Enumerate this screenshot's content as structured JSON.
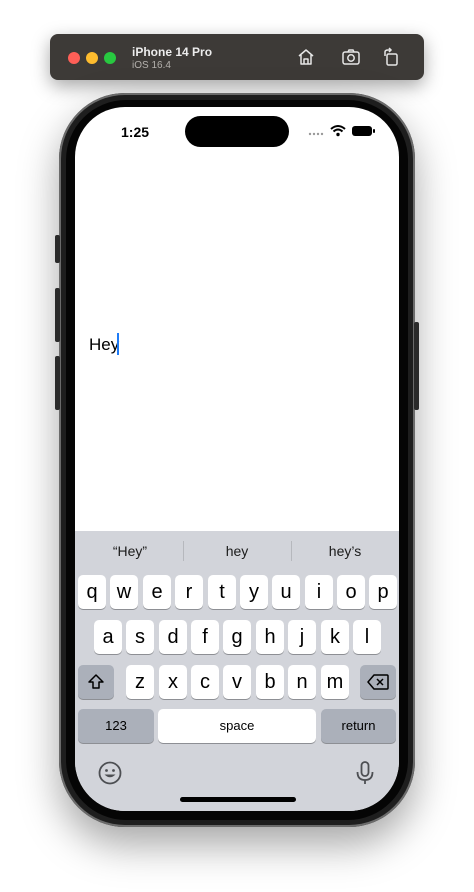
{
  "simulator": {
    "device_name": "iPhone 14 Pro",
    "os_version": "iOS 16.4",
    "toolbar_icons": [
      "home-icon",
      "screenshot-icon",
      "rotate-icon"
    ]
  },
  "status_bar": {
    "time": "1:25",
    "icons": [
      "cellular-dots-icon",
      "wifi-icon",
      "battery-icon"
    ]
  },
  "editor": {
    "text": "Hey",
    "caret_color": "#1f7bf6"
  },
  "keyboard": {
    "suggestions": [
      "“Hey”",
      "hey",
      "hey’s"
    ],
    "rows": [
      [
        "q",
        "w",
        "e",
        "r",
        "t",
        "y",
        "u",
        "i",
        "o",
        "p"
      ],
      [
        "a",
        "s",
        "d",
        "f",
        "g",
        "h",
        "j",
        "k",
        "l"
      ],
      [
        "z",
        "x",
        "c",
        "v",
        "b",
        "n",
        "m"
      ]
    ],
    "numbers_label": "123",
    "space_label": "space",
    "return_label": "return",
    "icons": [
      "shift-icon",
      "backspace-icon",
      "emoji-icon",
      "microphone-icon"
    ]
  }
}
